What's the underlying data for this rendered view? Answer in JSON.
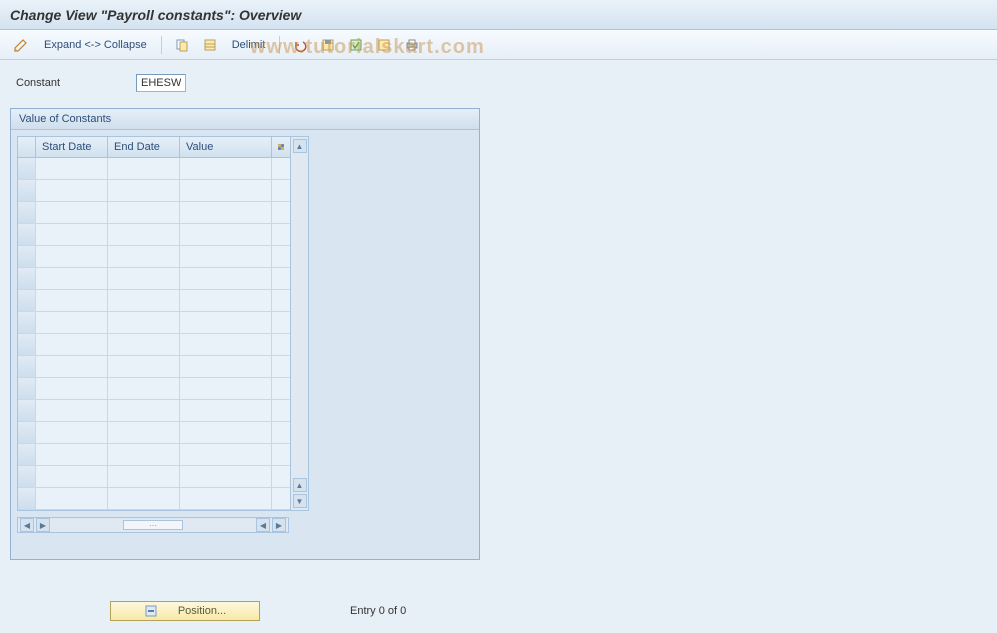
{
  "title": "Change View \"Payroll constants\": Overview",
  "toolbar": {
    "expand_collapse": "Expand <-> Collapse",
    "delimit": "Delimit"
  },
  "constant_field": {
    "label": "Constant",
    "value": "EHESW"
  },
  "panel": {
    "title": "Value of Constants",
    "columns": {
      "start_date": "Start Date",
      "end_date": "End Date",
      "value": "Value"
    },
    "rows": [
      {
        "start": "",
        "end": "",
        "value": ""
      },
      {
        "start": "",
        "end": "",
        "value": ""
      },
      {
        "start": "",
        "end": "",
        "value": ""
      },
      {
        "start": "",
        "end": "",
        "value": ""
      },
      {
        "start": "",
        "end": "",
        "value": ""
      },
      {
        "start": "",
        "end": "",
        "value": ""
      },
      {
        "start": "",
        "end": "",
        "value": ""
      },
      {
        "start": "",
        "end": "",
        "value": ""
      },
      {
        "start": "",
        "end": "",
        "value": ""
      },
      {
        "start": "",
        "end": "",
        "value": ""
      },
      {
        "start": "",
        "end": "",
        "value": ""
      },
      {
        "start": "",
        "end": "",
        "value": ""
      },
      {
        "start": "",
        "end": "",
        "value": ""
      },
      {
        "start": "",
        "end": "",
        "value": ""
      },
      {
        "start": "",
        "end": "",
        "value": ""
      },
      {
        "start": "",
        "end": "",
        "value": ""
      }
    ]
  },
  "footer": {
    "position_label": "Position...",
    "entry_text": "Entry 0 of 0"
  },
  "watermark": "www.tutorialskart.com"
}
